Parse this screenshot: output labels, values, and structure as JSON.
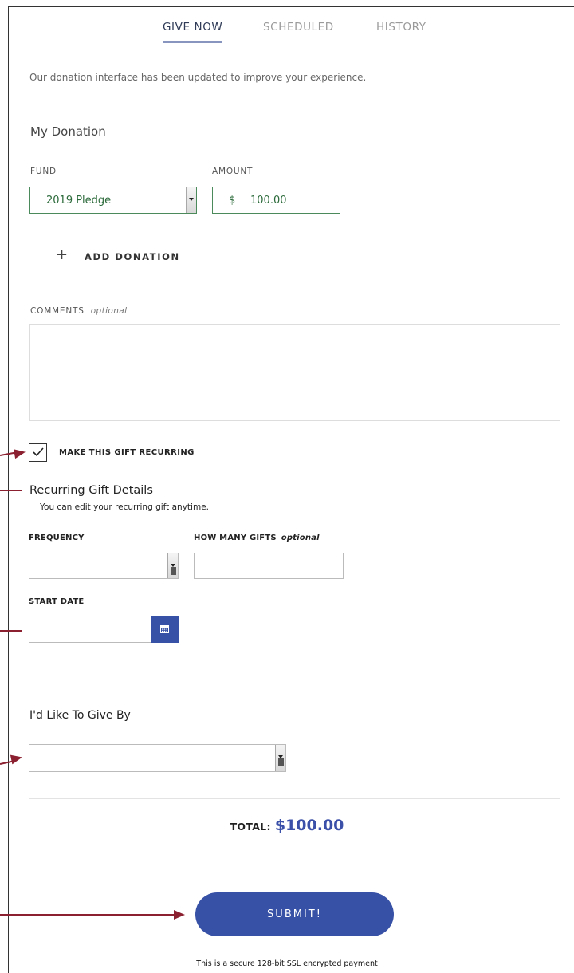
{
  "tabs": {
    "give_now": "GIVE NOW",
    "scheduled": "SCHEDULED",
    "history": "HISTORY"
  },
  "notice": "Our donation interface has been updated to improve your experience.",
  "donation": {
    "title": "My Donation",
    "fund_label": "FUND",
    "fund_value": "2019 Pledge",
    "amount_label": "AMOUNT",
    "currency": "$",
    "amount_value": "100.00",
    "add_donation": "ADD DONATION"
  },
  "comments": {
    "label": "COMMENTS",
    "optional": "optional",
    "value": ""
  },
  "recurring": {
    "checkbox_label": "MAKE THIS GIFT RECURRING",
    "checked": true,
    "details_title": "Recurring Gift Details",
    "details_sub": "You can edit your recurring gift anytime.",
    "frequency_label": "FREQUENCY",
    "frequency_value": "",
    "how_many_label": "HOW MANY GIFTS",
    "how_many_optional": "optional",
    "how_many_value": "",
    "start_date_label": "START DATE",
    "start_date_value": ""
  },
  "payment": {
    "title": "I'd Like To Give By",
    "method_value": ""
  },
  "total": {
    "label": "TOTAL:",
    "amount": "$100.00"
  },
  "submit_label": "SUBMIT!",
  "secure_note": "This is a secure 128-bit SSL encrypted payment",
  "colors": {
    "accent": "#3751a6",
    "fund_border": "#4b8a5a",
    "annotation_arrow": "#8b2030"
  }
}
